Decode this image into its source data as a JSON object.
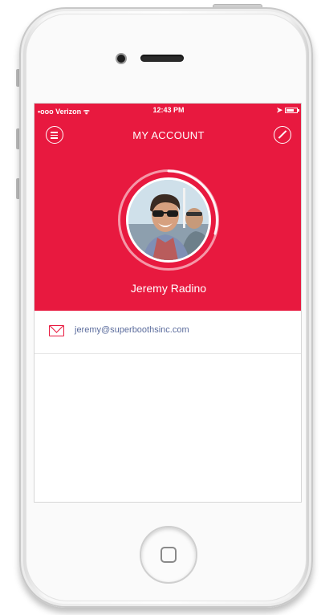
{
  "status_bar": {
    "carrier": "•ooo Verizon ᯤ",
    "time": "12:43 PM",
    "location_glyph": "➤"
  },
  "nav": {
    "title": "MY ACCOUNT",
    "menu_icon": "menu-icon",
    "edit_icon": "edit-pencil-icon"
  },
  "profile": {
    "name": "Jeremy Radino"
  },
  "contact": {
    "email": "jeremy@superboothsinc.com",
    "email_icon": "mail-icon"
  },
  "colors": {
    "accent": "#e8193f",
    "email_text": "#5a6b9c"
  }
}
